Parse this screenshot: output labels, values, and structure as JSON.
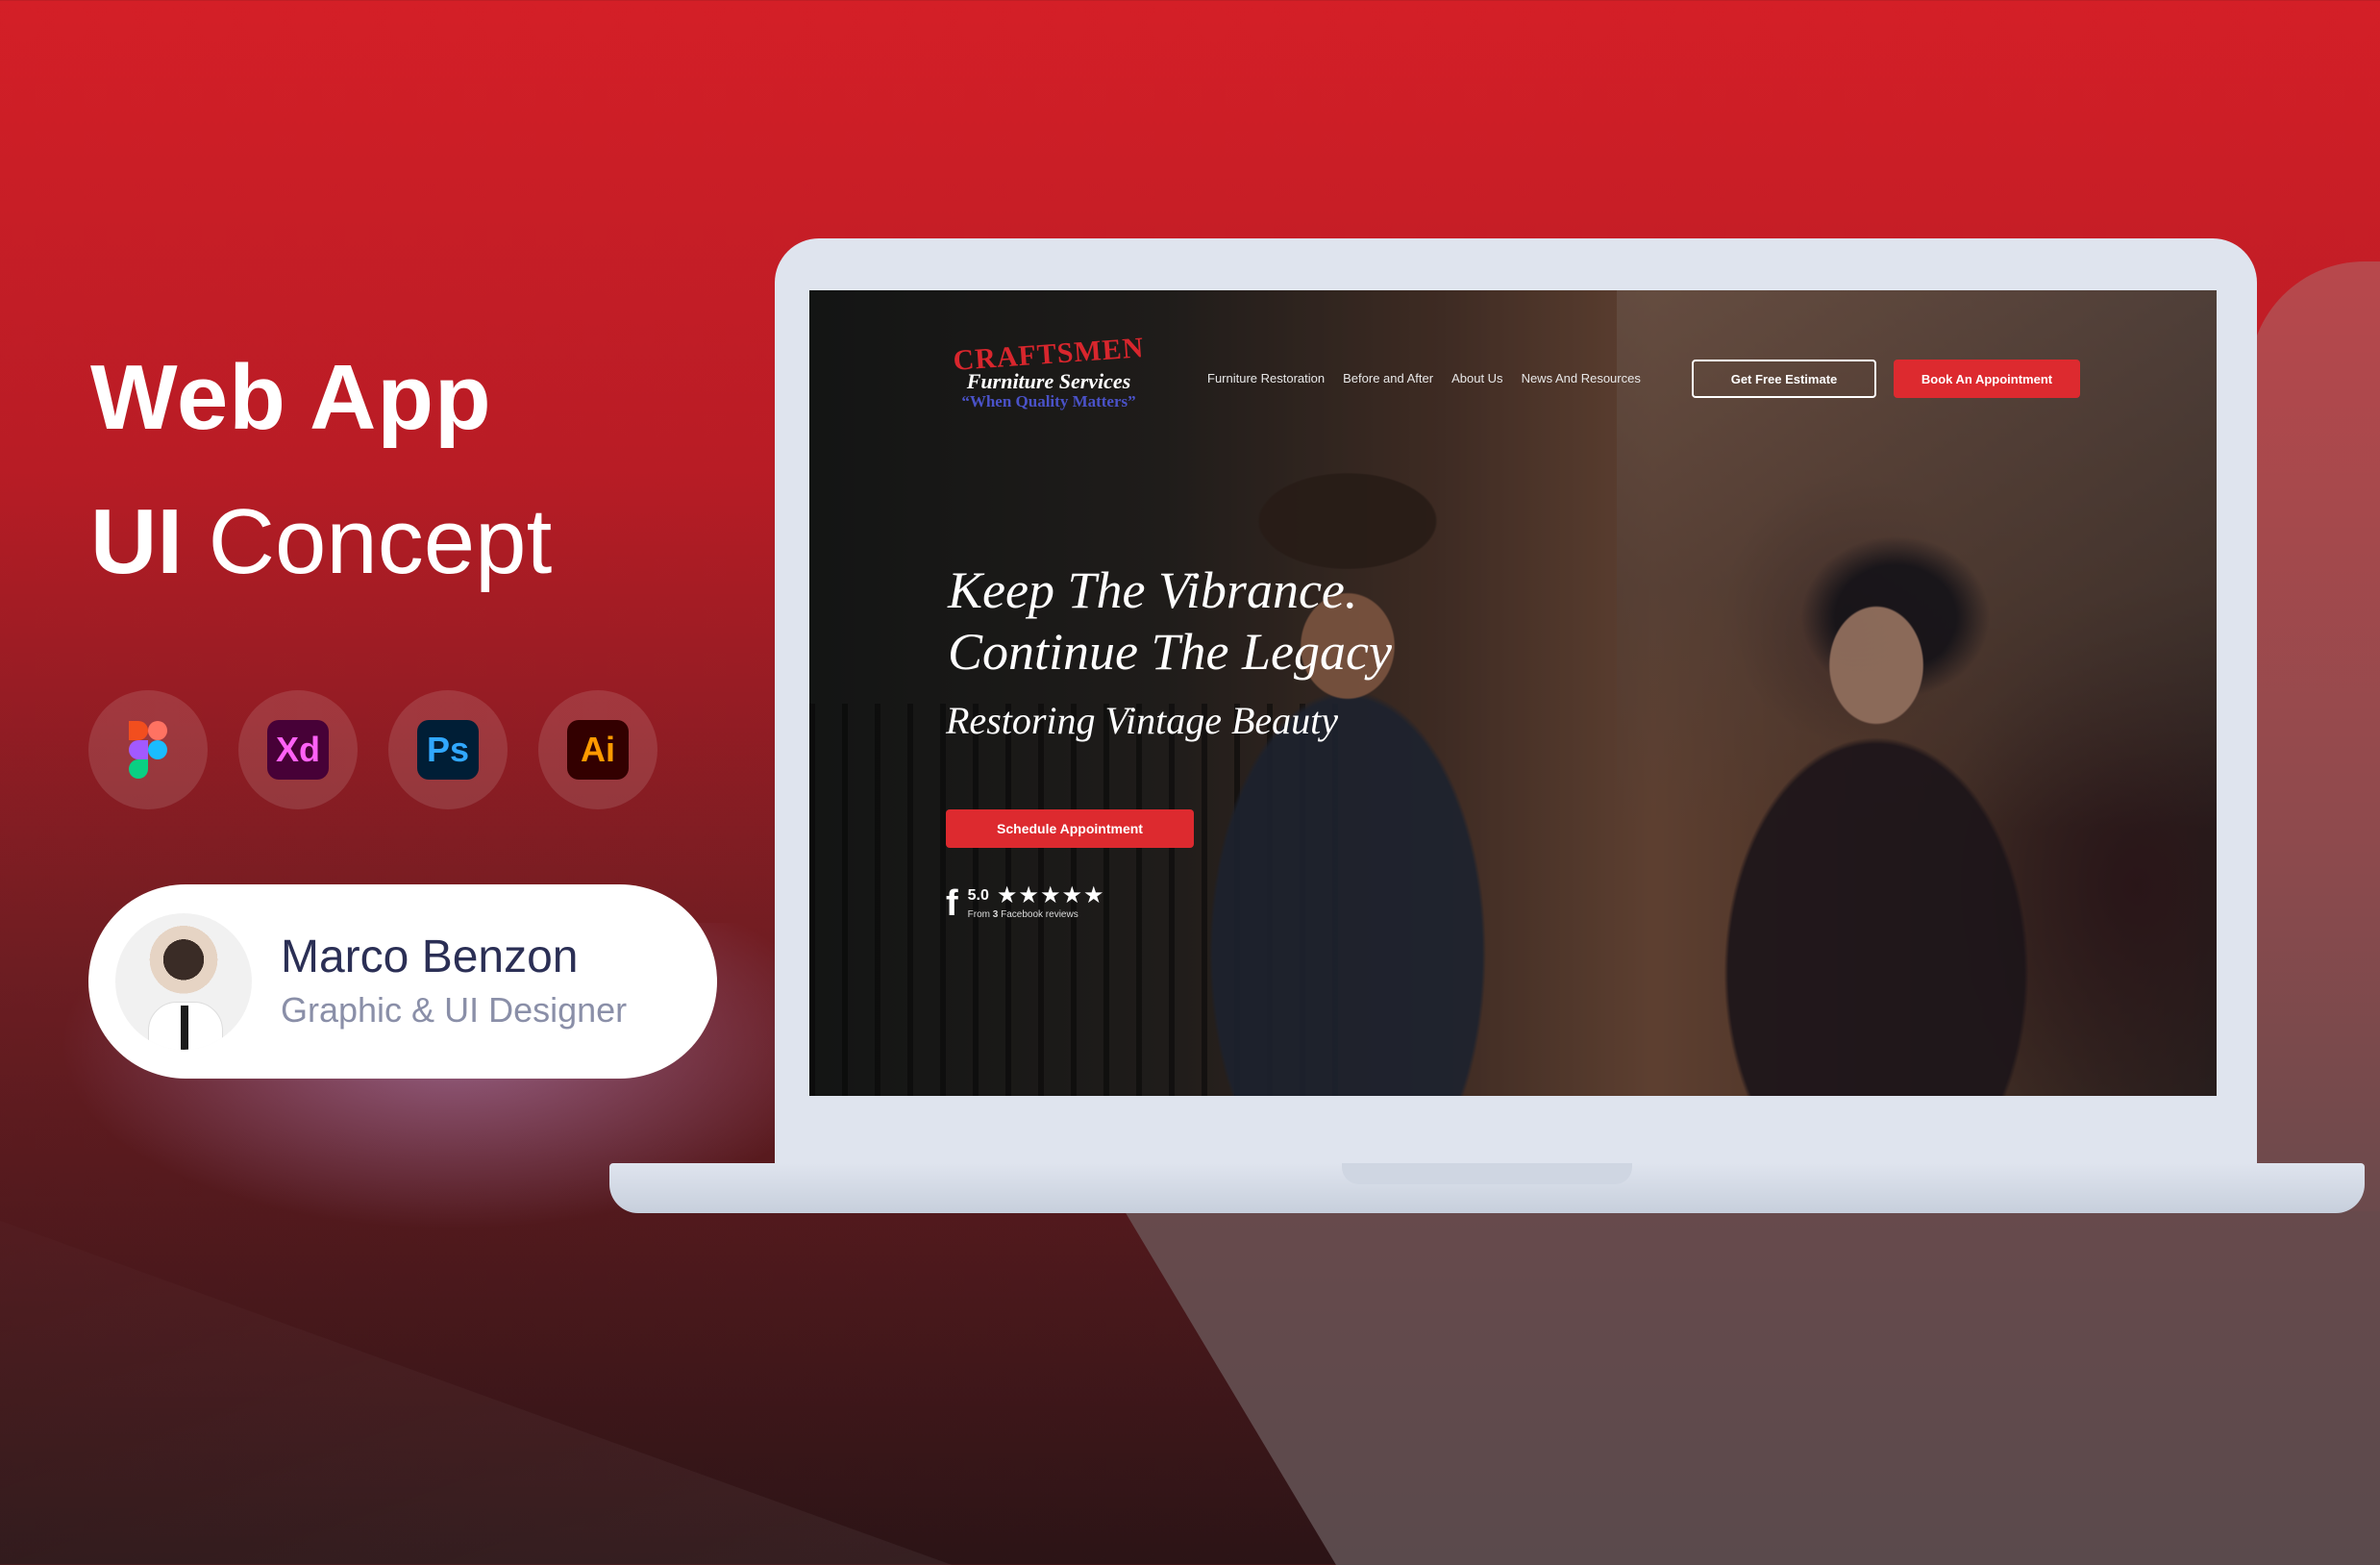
{
  "promo": {
    "headline_line1": "Web App",
    "headline_line2_bold": "UI",
    "headline_line2_rest": "Concept",
    "tools": [
      {
        "name": "figma-icon",
        "label": ""
      },
      {
        "name": "adobe-xd-icon",
        "label": "Xd"
      },
      {
        "name": "photoshop-icon",
        "label": "Ps"
      },
      {
        "name": "illustrator-icon",
        "label": "Ai"
      }
    ],
    "designer": {
      "name": "Marco Benzon",
      "role": "Graphic & UI Designer"
    }
  },
  "site": {
    "logo": {
      "top": "CRAFTSMEN",
      "mid": "Furniture Services",
      "tagline": "“When Quality Matters”"
    },
    "nav": [
      "Furniture Restoration",
      "Before and After",
      "About Us",
      "News And Resources"
    ],
    "cta_estimate": "Get Free Estimate",
    "cta_book": "Book An Appointment",
    "hero_line1": "Keep The Vibrance.",
    "hero_line2": "Continue The Legacy",
    "hero_sub": "Restoring Vintage Beauty",
    "cta_schedule": "Schedule Appointment",
    "rating": {
      "score": "5.0",
      "stars": "★★★★★",
      "from_prefix": "From ",
      "from_count": "3",
      "from_suffix": " Facebook reviews"
    }
  },
  "colors": {
    "brand_red": "#dd2a2f",
    "bg_red": "#d41f27",
    "logo_blue": "#4a52c8"
  }
}
